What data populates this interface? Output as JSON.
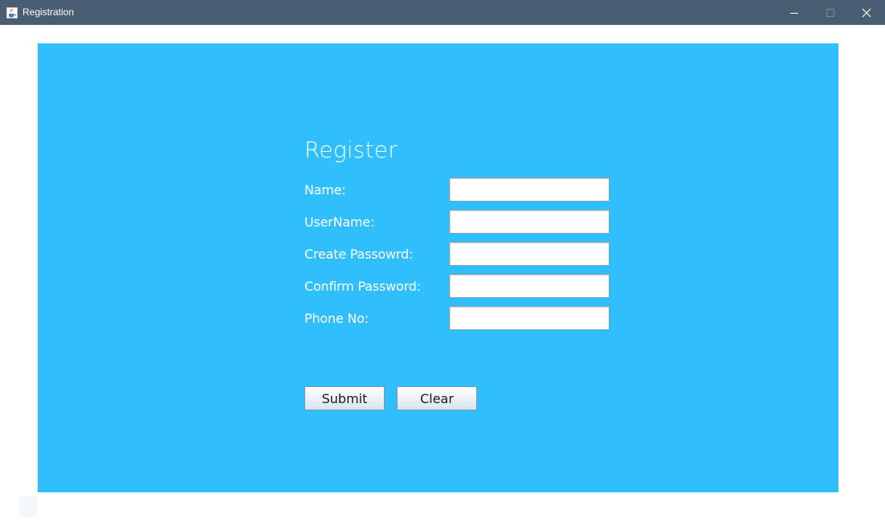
{
  "window": {
    "title": "Registration",
    "icon": "java-cup-icon",
    "controls": [
      "minimize-icon",
      "maximize-icon",
      "close-icon"
    ]
  },
  "form": {
    "heading": "Register",
    "fields": [
      {
        "label": "Name:",
        "value": ""
      },
      {
        "label": "UserName:",
        "value": ""
      },
      {
        "label": "Create Passowrd:",
        "value": ""
      },
      {
        "label": "Confirm Password:",
        "value": ""
      },
      {
        "label": "Phone No:",
        "value": ""
      }
    ],
    "buttons": {
      "submit": "Submit",
      "clear": "Clear"
    }
  },
  "colors": {
    "titlebar": "#4a5e72",
    "panel": "#2ebffc",
    "text": "#ffffff"
  }
}
